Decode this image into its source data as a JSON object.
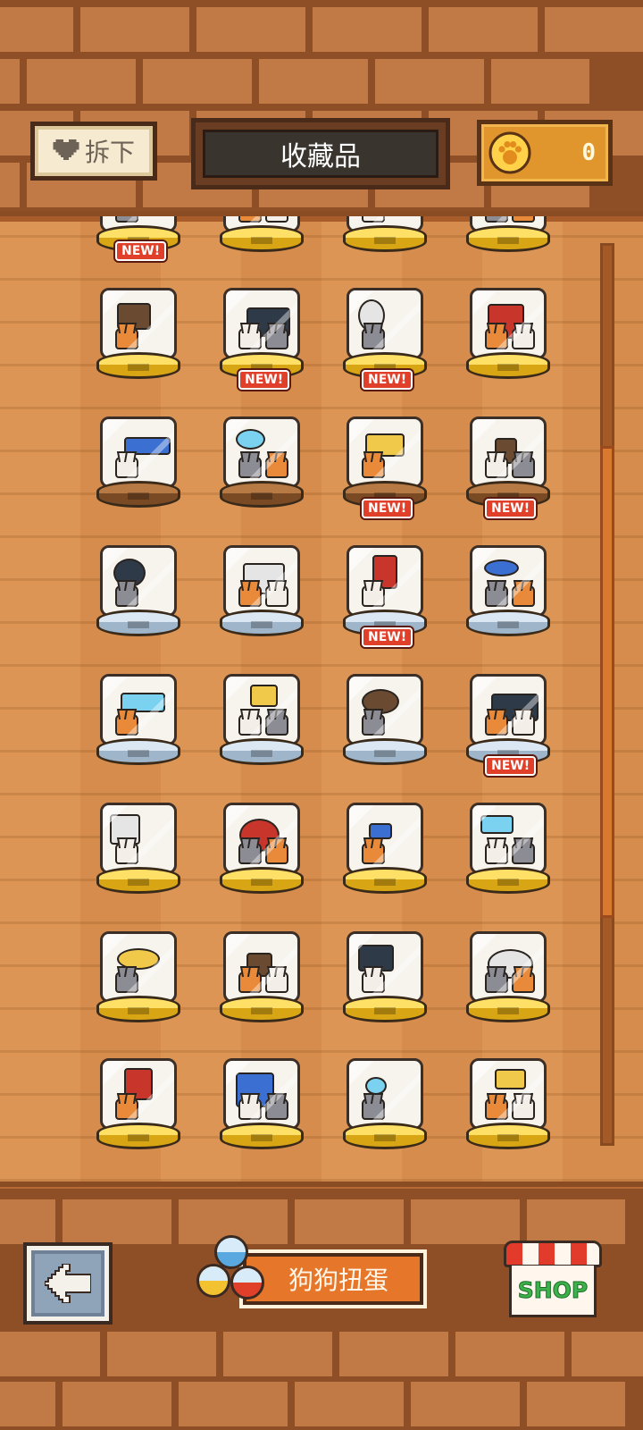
{
  "header": {
    "unequip_label": "拆下",
    "title": "收藏品",
    "coins": "0"
  },
  "badge_label": "NEW!",
  "footer": {
    "gacha_label": "狗狗扭蛋",
    "shop_label": "SHOP"
  },
  "collection": {
    "rows": [
      {
        "pedestal": "gold",
        "items": [
          {
            "new": false
          },
          {
            "new": false
          },
          {
            "new": false
          },
          {
            "new": false
          }
        ]
      },
      {
        "pedestal": "gold",
        "items": [
          {
            "new": true
          },
          {
            "new": false
          },
          {
            "new": false
          },
          {
            "new": false
          }
        ]
      },
      {
        "pedestal": "bronze",
        "items": [
          {
            "new": false
          },
          {
            "new": true
          },
          {
            "new": true
          },
          {
            "new": false
          }
        ]
      },
      {
        "pedestal": "silver",
        "items": [
          {
            "new": false
          },
          {
            "new": false
          },
          {
            "new": true
          },
          {
            "new": true
          }
        ]
      },
      {
        "pedestal": "silver",
        "items": [
          {
            "new": false
          },
          {
            "new": false
          },
          {
            "new": true
          },
          {
            "new": false
          }
        ]
      },
      {
        "pedestal": "gold",
        "items": [
          {
            "new": false
          },
          {
            "new": false
          },
          {
            "new": false
          },
          {
            "new": true
          }
        ]
      },
      {
        "pedestal": "gold",
        "items": [
          {
            "new": false
          },
          {
            "new": false
          },
          {
            "new": false
          },
          {
            "new": false
          }
        ]
      },
      {
        "pedestal": "gold",
        "items": [
          {
            "new": false
          },
          {
            "new": false
          },
          {
            "new": false
          },
          {
            "new": false
          }
        ]
      }
    ]
  },
  "colors": {
    "accent_orange": "#e5762a",
    "new_badge": "#e0402a",
    "coin_gold": "#e0962c",
    "wood": "#d9904f"
  },
  "icons": {
    "unequip": "heart-icon",
    "coin": "paw-coin-icon",
    "back": "arrow-left-icon"
  },
  "scroll": {
    "position": 0.47
  }
}
